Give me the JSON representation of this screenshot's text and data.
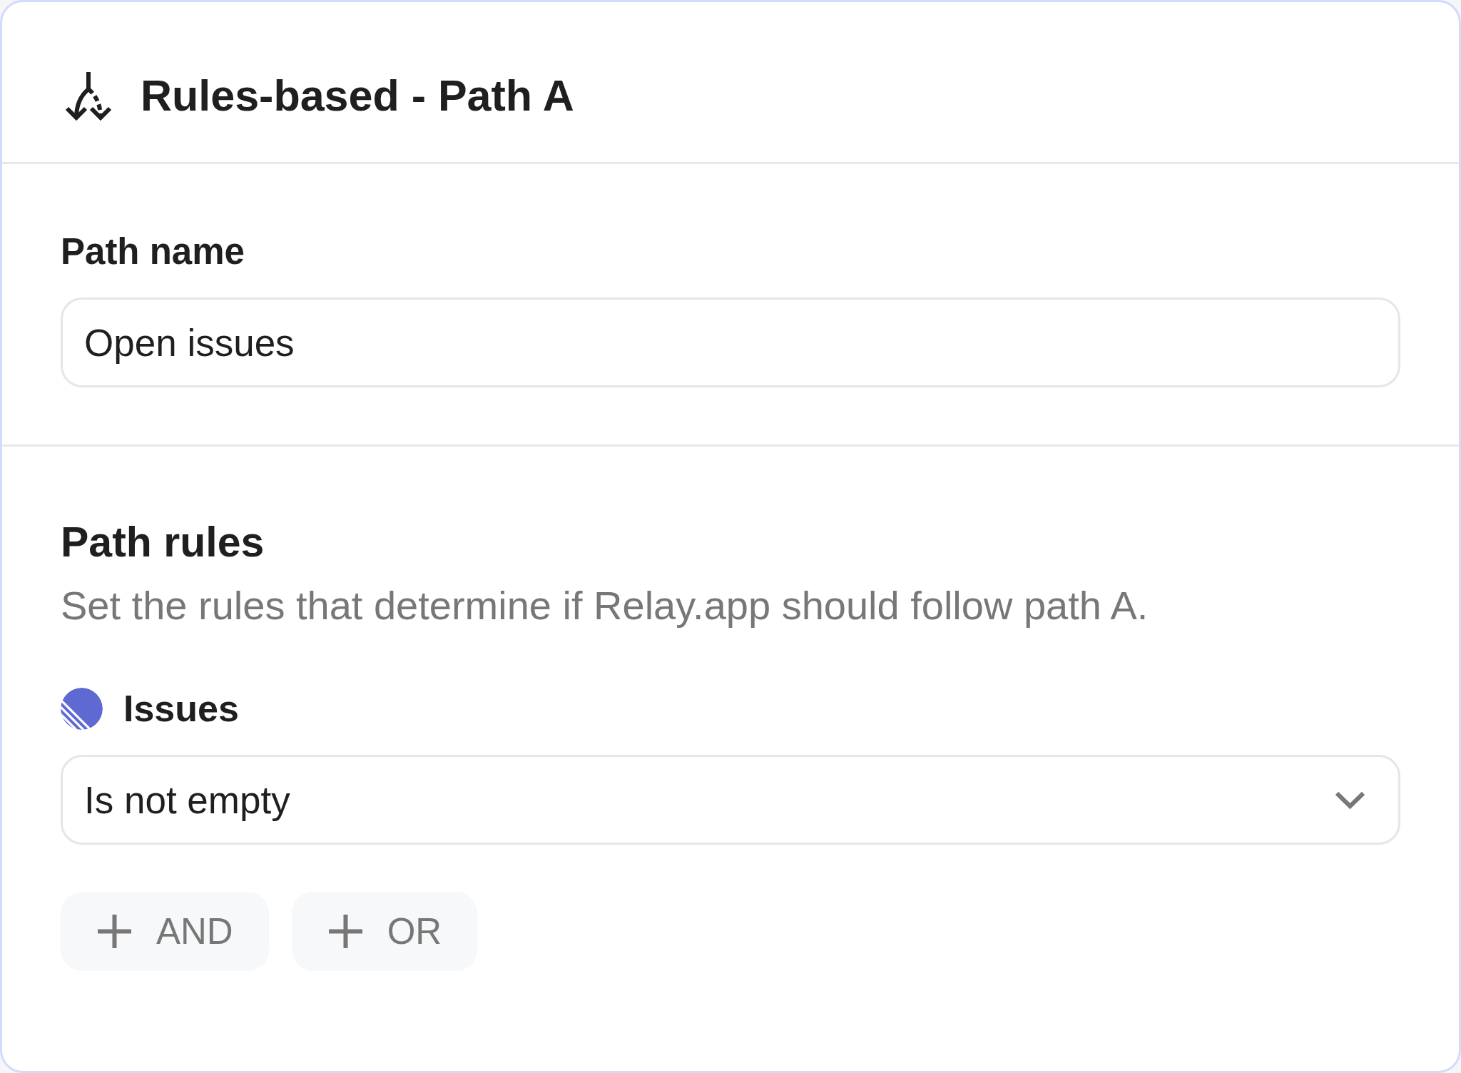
{
  "header": {
    "title": "Rules-based - Path A"
  },
  "path_name": {
    "label": "Path name",
    "value": "Open issues"
  },
  "path_rules": {
    "title": "Path rules",
    "description": "Set the rules that determine if Relay.app should follow path A.",
    "rules": [
      {
        "field": "Issues",
        "condition": "Is not empty"
      }
    ],
    "buttons": [
      "AND",
      "OR"
    ]
  }
}
